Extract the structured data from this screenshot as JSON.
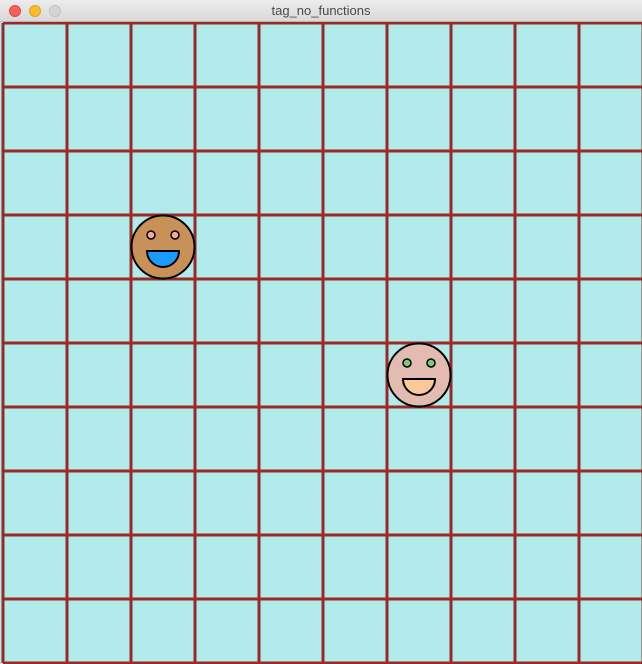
{
  "window": {
    "title": "tag_no_functions"
  },
  "colors": {
    "cell_fill": "#b2ebeb",
    "grid_line": "#9b2a24",
    "face_outline": "#000000"
  },
  "grid": {
    "columns": 10,
    "rows": 10
  },
  "faces": [
    {
      "name": "brown-face",
      "col": 2,
      "row": 3,
      "skin": "#c89158",
      "eye": "#f4a6a0",
      "mouth": "#1a9bff"
    },
    {
      "name": "pink-face",
      "col": 6,
      "row": 5,
      "skin": "#e2bcb0",
      "eye": "#7ecb73",
      "mouth": "#fcc899"
    }
  ]
}
